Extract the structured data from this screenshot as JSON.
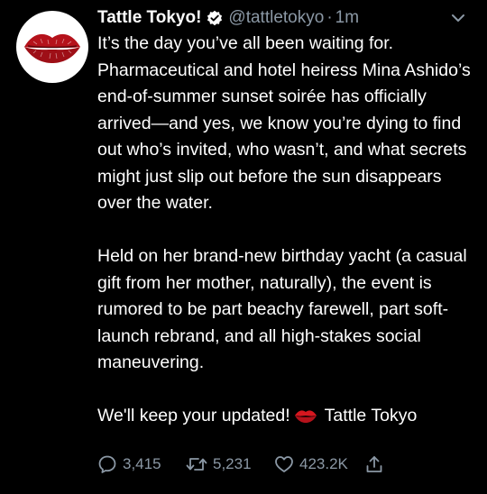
{
  "tweet": {
    "display_name": "Tattle Tokyo!",
    "handle": "@tattletokyo",
    "separator": "·",
    "time": "1m",
    "paragraph1": "It’s the day you’ve all been waiting for. Pharmaceutical and hotel heiress Mina Ashido’s end-of-summer sunset soirée has officially arrived—and yes, we know you’re dying to find out who’s invited, who wasn’t, and what secrets might just slip out before the sun disappears over the water.",
    "paragraph2": "Held on her brand-new birthday yacht (a casual gift from her mother, naturally), the event is rumored to be part beachy farewell, part soft-launch rebrand, and all high-stakes social maneuvering.",
    "paragraph3_start": "We'll keep your updated!",
    "paragraph3_end": "Tattle Tokyo",
    "replies": "3,415",
    "retweets": "5,231",
    "likes": "423.2K"
  },
  "icons": {
    "avatar": "red-lips-logo",
    "verified": "verified-badge-icon",
    "more": "chevron-down-icon",
    "inline_emoji": "kiss-mark-emoji",
    "reply": "reply-icon",
    "retweet": "retweet-icon",
    "like": "heart-icon",
    "share": "share-icon"
  },
  "colors": {
    "background": "#000000",
    "text": "#ffffff",
    "muted": "#8b98a5",
    "lips": "#b5121b"
  }
}
